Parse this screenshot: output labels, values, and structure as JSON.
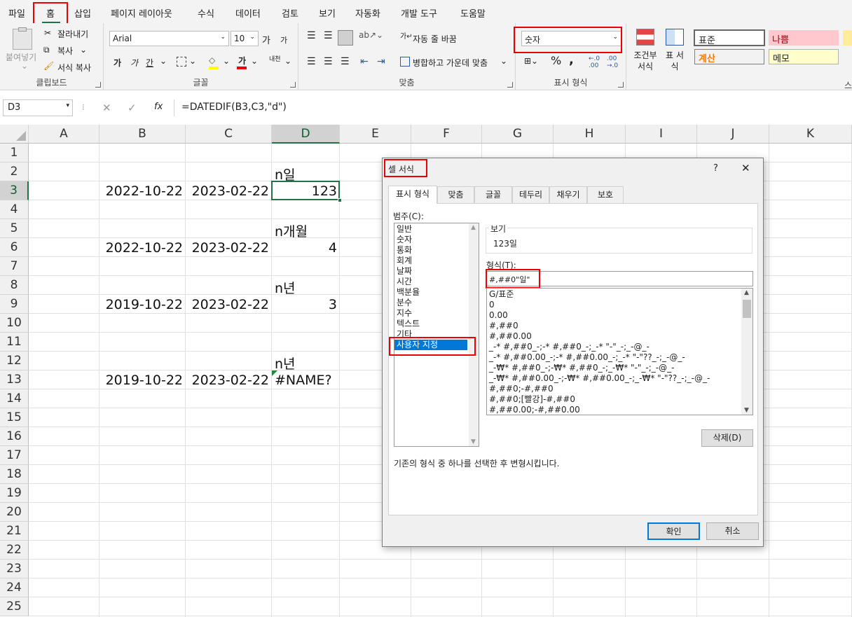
{
  "menu": {
    "tabs": [
      "파일",
      "홈",
      "삽입",
      "페이지 레이아웃",
      "수식",
      "데이터",
      "검토",
      "보기",
      "자동화",
      "개발 도구",
      "도움말"
    ]
  },
  "ribbon": {
    "clipboard": {
      "paste": "붙여넣기",
      "cut": "잘라내기",
      "copy": "복사",
      "format_painter": "서식 복사",
      "label": "클립보드"
    },
    "font": {
      "name": "Arial",
      "size": "10",
      "grow": "가",
      "shrink": "가",
      "bold": "가",
      "italic": "가",
      "underline": "간",
      "color": "가",
      "phonetic": "내천",
      "label": "글꼴"
    },
    "align": {
      "wrap": "자동 줄 바꿈",
      "merge": "병합하고 가운데 맞춤",
      "label": "맞춤"
    },
    "number": {
      "format": "숫자",
      "pct": "%",
      "comma": ",",
      "label": "표시 형식"
    },
    "styles": {
      "cond": "조건부 서식",
      "table": "표 서식",
      "normal": "표준",
      "bad": "나쁨",
      "calc": "계산",
      "memo": "메모",
      "cut_label": "스"
    }
  },
  "formula": {
    "namebox": "D3",
    "fx": "fx",
    "content": "=DATEDIF(B3,C3,\"d\")"
  },
  "grid": {
    "cols": [
      "A",
      "B",
      "C",
      "D",
      "E",
      "F",
      "G",
      "H",
      "I",
      "J",
      "K"
    ],
    "rows": [
      "1",
      "2",
      "3",
      "4",
      "5",
      "6",
      "7",
      "8",
      "9",
      "10",
      "11",
      "12",
      "13",
      "14",
      "15",
      "16",
      "17",
      "18",
      "19",
      "20",
      "21",
      "22",
      "23",
      "24",
      "25"
    ],
    "cells": {
      "d2": "n일",
      "b3": "2022-10-22",
      "c3": "2023-02-22",
      "d3": "123",
      "d5": "n개월",
      "b6": "2022-10-22",
      "c6": "2023-02-22",
      "d6": "4",
      "d8": "n년",
      "b9": "2019-10-22",
      "c9": "2023-02-22",
      "d9": "3",
      "d12": "n년",
      "b13": "2019-10-22",
      "c13": "2023-02-22",
      "d13": "#NAME?"
    }
  },
  "dialog": {
    "title": "셀 서식",
    "help": "?",
    "close": "✕",
    "tabs": [
      "표시 형식",
      "맞춤",
      "글꼴",
      "테두리",
      "채우기",
      "보호"
    ],
    "category_label": "범주(C):",
    "categories": [
      "일반",
      "숫자",
      "통화",
      "회계",
      "날짜",
      "시간",
      "백분율",
      "분수",
      "지수",
      "텍스트",
      "기타",
      "사용자 지정"
    ],
    "sample_label": "보기",
    "sample_value": "123일",
    "type_label": "형식(T):",
    "type_value": "#,##0\"일\"",
    "formats": [
      "G/표준",
      "0",
      "0.00",
      "#,##0",
      "#,##0.00",
      "_-* #,##0_-;-* #,##0_-;_-* \"-\"_-;_-@_-",
      "_-* #,##0.00_-;-* #,##0.00_-;_-* \"-\"??_-;_-@_-",
      "_-₩* #,##0_-;-₩* #,##0_-;_-₩* \"-\"_-;_-@_-",
      "_-₩* #,##0.00_-;-₩* #,##0.00_-;_-₩* \"-\"??_-;_-@_-",
      "#,##0;-#,##0",
      "#,##0;[빨강]-#,##0",
      "#,##0.00;-#,##0.00"
    ],
    "delete": "삭제(D)",
    "description": "기존의 형식 중 하나를 선택한 후 변형시킵니다.",
    "ok": "확인",
    "cancel": "취소"
  }
}
